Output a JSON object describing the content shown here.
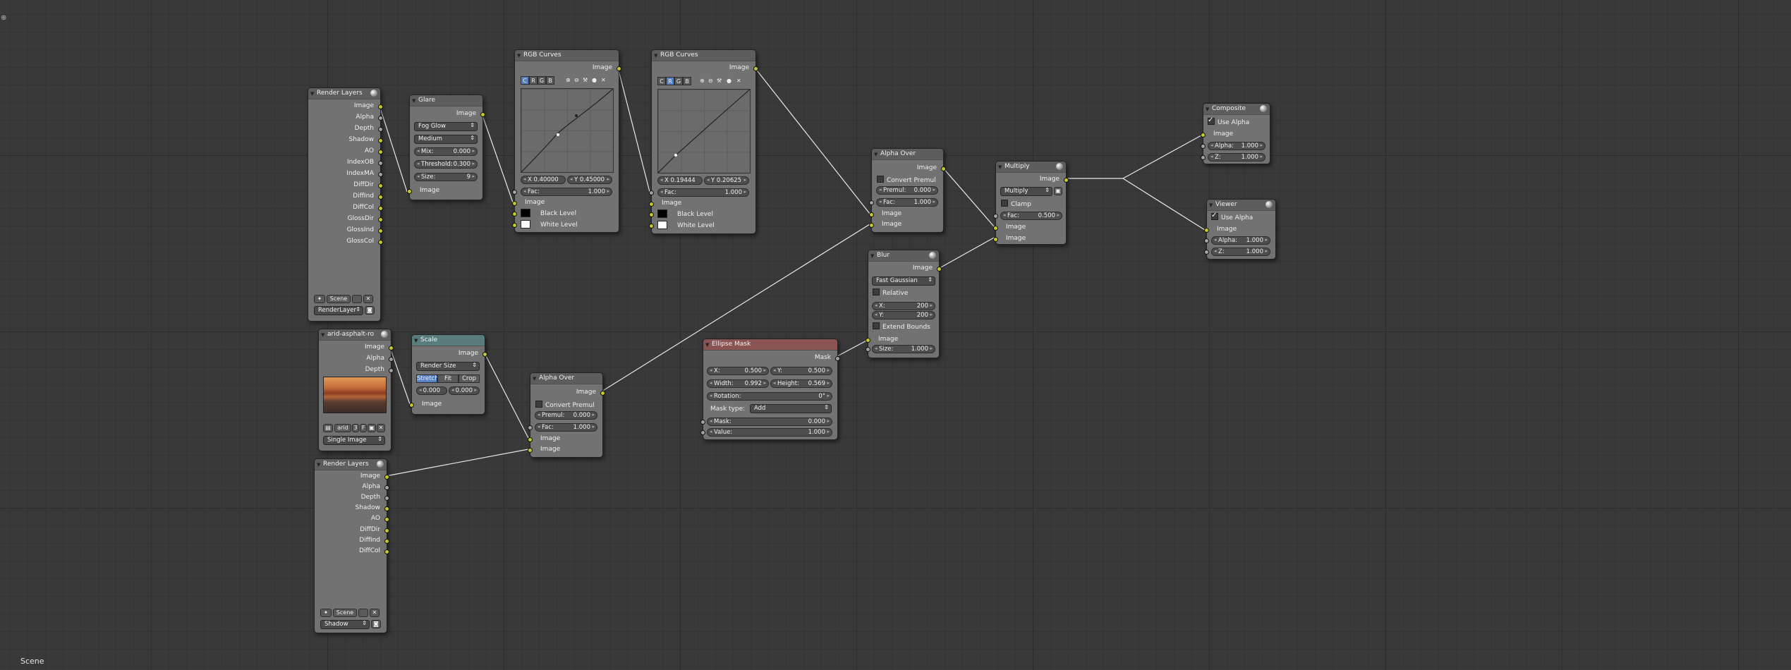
{
  "status_bar": {
    "scene_label": "Scene"
  },
  "colors": {
    "image_socket": "#c7c729",
    "value_socket": "#a3a3a3",
    "selected": "#5680c2",
    "scale_header": "#5a7c7c",
    "mask_header": "#8a5454"
  },
  "icons": [
    "collapse-triangle-icon",
    "node-options-sphere-icon",
    "checkmark-icon",
    "curve-tool-icons",
    "scene-icon",
    "image-icon"
  ],
  "nodes": {
    "render_layers_1": {
      "title": "Render Layers",
      "outputs": [
        "Image",
        "Alpha",
        "Depth",
        "Shadow",
        "AO",
        "IndexOB",
        "IndexMA",
        "DiffDir",
        "DiffInd",
        "DiffCol",
        "GlossDir",
        "GlossInd",
        "GlossCol"
      ],
      "scene": "Scene",
      "layer": "RenderLayer"
    },
    "glare": {
      "title": "Glare",
      "output": "Image",
      "type": "Fog Glow",
      "quality": "Medium",
      "mix_label": "Mix:",
      "mix": "0.000",
      "threshold_label": "Threshold:",
      "threshold": "0.300",
      "size_label": "Size:",
      "size": "9",
      "input": "Image"
    },
    "rgb_curves_1": {
      "title": "RGB Curves",
      "output": "Image",
      "channels": [
        "C",
        "R",
        "G",
        "B"
      ],
      "x": "X 0.40000",
      "y": "Y 0.45000",
      "fac_label": "Fac:",
      "fac": "1.000",
      "inputs": [
        "Image",
        "Black Level",
        "White Level"
      ]
    },
    "rgb_curves_2": {
      "title": "RGB Curves",
      "output": "Image",
      "channels": [
        "C",
        "R",
        "G",
        "B"
      ],
      "x": "X 0.19444",
      "y": "Y 0.20625",
      "fac_label": "Fac:",
      "fac": "1.000",
      "inputs": [
        "Image",
        "Black Level",
        "White Level"
      ]
    },
    "alpha_over_1": {
      "title": "Alpha Over",
      "output": "Image",
      "convert": "Convert Premul",
      "premul_label": "Premul:",
      "premul": "0.000",
      "fac_label": "Fac:",
      "fac": "1.000",
      "inputs": [
        "Image",
        "Image"
      ]
    },
    "multiply": {
      "title": "Multiply",
      "output": "Image",
      "blend": "Multiply",
      "clamp": "Clamp",
      "fac_label": "Fac:",
      "fac": "0.500",
      "inputs": [
        "Image",
        "Image"
      ]
    },
    "composite": {
      "title": "Composite",
      "use_alpha": "Use Alpha",
      "input": "Image",
      "alpha_label": "Alpha:",
      "alpha": "1.000",
      "z_label": "Z:",
      "z": "1.000"
    },
    "viewer": {
      "title": "Viewer",
      "use_alpha": "Use Alpha",
      "input": "Image",
      "alpha_label": "Alpha:",
      "alpha": "1.000",
      "z_label": "Z:",
      "z": "1.000"
    },
    "blur": {
      "title": "Blur",
      "output": "Image",
      "filter": "Fast Gaussian",
      "relative": "Relative",
      "x_label": "X:",
      "x": "200",
      "y_label": "Y:",
      "y": "200",
      "extend": "Extend Bounds",
      "input": "Image",
      "size_label": "Size:",
      "size": "1.000"
    },
    "ellipse_mask": {
      "title": "Ellipse Mask",
      "output": "Mask",
      "x_label": "X:",
      "x": "0.500",
      "y_label": "Y:",
      "y": "0.500",
      "width_label": "Width:",
      "width": "0.992",
      "height_label": "Height:",
      "height": "0.569",
      "rotation_label": "Rotation:",
      "rotation": "0°",
      "mask_type_label": "Mask type:",
      "mask_type": "Add",
      "mask_label": "Mask:",
      "mask": "0.000",
      "value_label": "Value:",
      "value": "1.000"
    },
    "image": {
      "title": "arid-asphalt-ro",
      "outputs": [
        "Image",
        "Alpha",
        "Depth"
      ],
      "image_name": "arid",
      "users": "3",
      "fake": "F",
      "source": "Single Image"
    },
    "scale": {
      "title": "Scale",
      "output": "Image",
      "space": "Render Size",
      "modes": [
        "Stretch",
        "Fit",
        "Crop"
      ],
      "offset_x": "0.000",
      "offset_y": "0.000",
      "input": "Image"
    },
    "alpha_over_2": {
      "title": "Alpha Over",
      "output": "Image",
      "convert": "Convert Premul",
      "premul_label": "Premul:",
      "premul": "0.000",
      "fac_label": "Fac:",
      "fac": "1.000",
      "inputs": [
        "Image",
        "Image"
      ]
    },
    "render_layers_2": {
      "title": "Render Layers",
      "outputs": [
        "Image",
        "Alpha",
        "Depth",
        "Shadow",
        "AO",
        "DiffDir",
        "DiffInd",
        "DiffCol"
      ],
      "scene": "Scene",
      "layer": "Shadow"
    }
  }
}
